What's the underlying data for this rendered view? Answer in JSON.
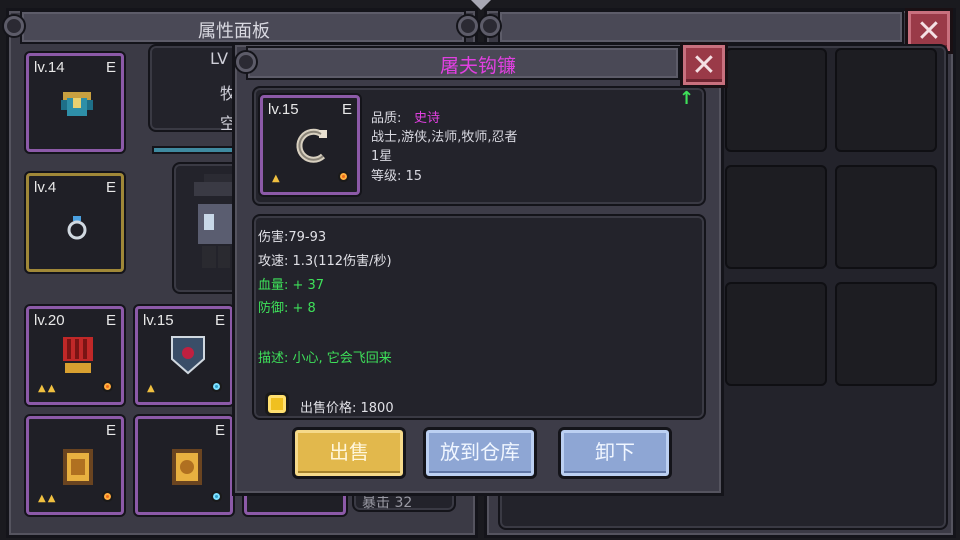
{
  "attr_panel": {
    "title": "属性面板",
    "hero_level_label": "LV",
    "hero_char_1": "牧",
    "hero_char_2": "空",
    "stat_partial": "暴击 32"
  },
  "equipment_slots": [
    {
      "level": "lv.14",
      "tag": "E",
      "item": "armor-icon",
      "stars": "",
      "gem": ""
    },
    {
      "level": "lv.4",
      "tag": "E",
      "item": "ring-icon",
      "stars": "",
      "gem": ""
    },
    {
      "level": "lv.20",
      "tag": "E",
      "item": "gauntlet-icon",
      "stars": "▲▲",
      "gem": "orange"
    },
    {
      "level": "lv.15",
      "tag": "E",
      "item": "shield-icon",
      "stars": "▲",
      "gem": "blue"
    },
    {
      "level": "",
      "tag": "E",
      "item": "tome-icon",
      "stars": "▲▲",
      "gem": "orange"
    },
    {
      "level": "",
      "tag": "E",
      "item": "tome-icon",
      "stars": "",
      "gem": "blue"
    }
  ],
  "item_popup": {
    "name": "屠夫钩镰",
    "close_symbol": "✕",
    "level": "lv.15",
    "tag": "E",
    "quality_label": "品质:",
    "quality_value": "史诗",
    "classes": "战士,游侠,法师,牧师,忍者",
    "stars": "1星",
    "grade": "等级: 15",
    "damage": "伤害:79-93",
    "attack_speed": "攻速: 1.3(112伤害/秒)",
    "hp_bonus": "血量: + 37",
    "def_bonus": "防御: + 8",
    "description": "描述: 小心, 它会飞回来",
    "sell_price": "出售价格: 1800",
    "buttons": {
      "sell": "出售",
      "store": "放到仓库",
      "unequip": "卸下"
    }
  },
  "inventory": {
    "close_symbol": "✕"
  },
  "colors": {
    "epic": "#e040e0",
    "bonus_green": "#3ee05a",
    "title_magenta": "#e040e0"
  }
}
